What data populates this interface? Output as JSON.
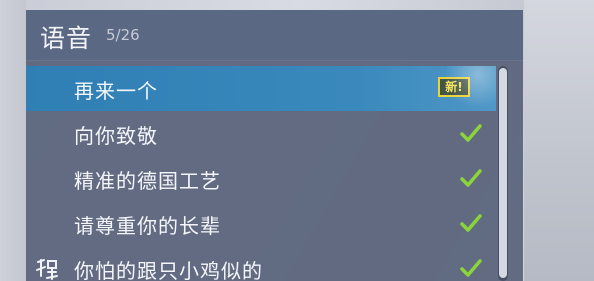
{
  "header": {
    "title": "语音",
    "count": "5/26"
  },
  "voice_lines": [
    {
      "label": "再来一个",
      "status": "new",
      "badge": "新!"
    },
    {
      "label": "向你致敬",
      "status": "owned"
    },
    {
      "label": "精准的德国工艺",
      "status": "owned"
    },
    {
      "label": "请尊重你的长辈",
      "status": "owned"
    },
    {
      "label": "你怕的跟只小鸡似的",
      "status": "owned",
      "icon": "character-glyph-icon"
    }
  ],
  "colors": {
    "selected_row": "#3a89bd",
    "check": "#8bd43a",
    "badge_border": "#e9d33a"
  }
}
